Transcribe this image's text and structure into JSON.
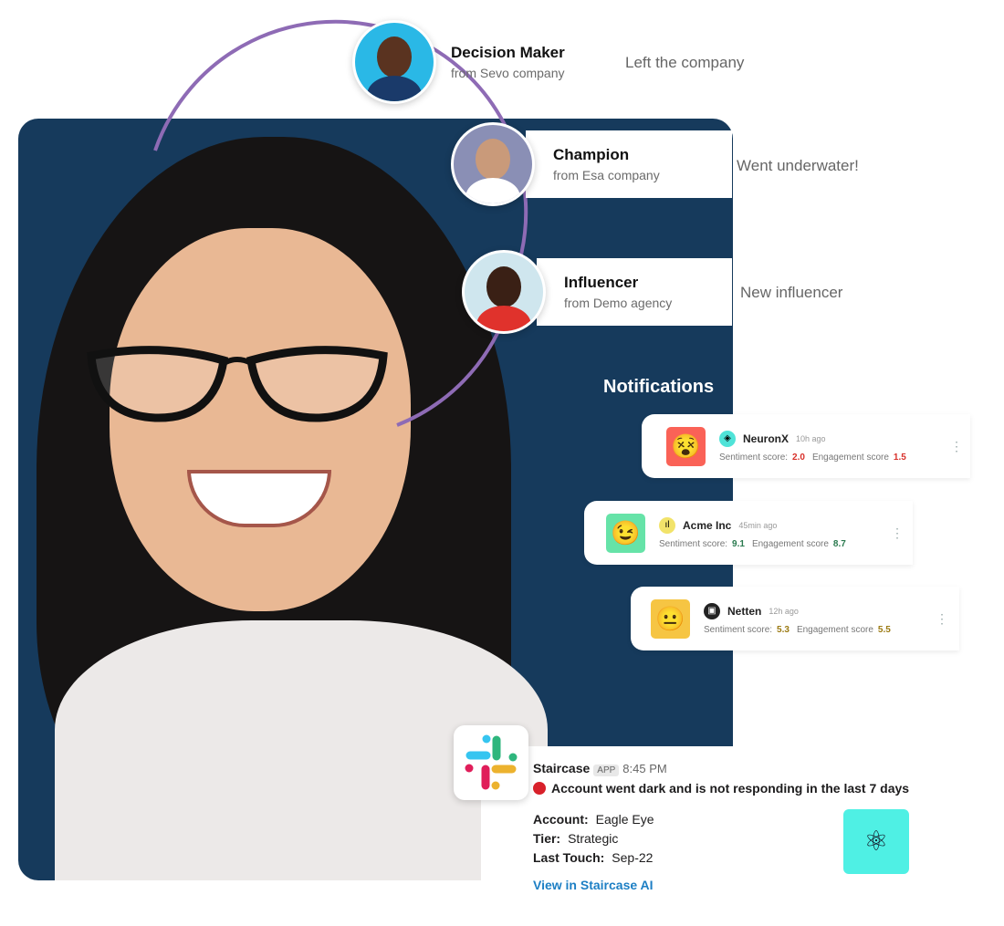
{
  "people": [
    {
      "role": "Decision Maker",
      "company": "from Sevo company",
      "status": "Left the company"
    },
    {
      "role": "Champion",
      "company": "from Esa company",
      "status": "Went underwater!"
    },
    {
      "role": "Influencer",
      "company": "from Demo agency",
      "status": "New influencer"
    }
  ],
  "notifications": {
    "title": "Notifications",
    "items": [
      {
        "name": "NeuronX",
        "time": "10h ago",
        "sentiment_label": "Sentiment score:",
        "sentiment": "2.0",
        "engagement_label": "Engagement score",
        "engagement": "1.5",
        "color": "#fa6257",
        "score_color": "#d8302a",
        "icon": "dizzy-face-icon"
      },
      {
        "name": "Acme Inc",
        "time": "45min ago",
        "sentiment_label": "Sentiment score:",
        "sentiment": "9.1",
        "engagement_label": "Engagement score",
        "engagement": "8.7",
        "color": "#66e3a8",
        "score_color": "#2b7a4f",
        "icon": "wink-face-icon"
      },
      {
        "name": "Netten",
        "time": "12h ago",
        "sentiment_label": "Sentiment score:",
        "sentiment": "5.3",
        "engagement_label": "Engagement score",
        "engagement": "5.5",
        "color": "#f6c543",
        "score_color": "#9b7a12",
        "icon": "neutral-face-icon"
      }
    ]
  },
  "slack": {
    "sender": "Staircase",
    "badge": "APP",
    "time": "8:45 PM",
    "message": "Account went dark and is not responding in the last 7 days",
    "fields": [
      {
        "label": "Account:",
        "value": "Eagle Eye"
      },
      {
        "label": "Tier:",
        "value": "Strategic"
      },
      {
        "label": "Last Touch:",
        "value": "Sep-22"
      }
    ],
    "link": "View in Staircase AI"
  },
  "colors": {
    "panel": "#163a5c",
    "arc": "#8e6bb5",
    "staircase": "#4ff0e4",
    "link": "#1d7fc4"
  }
}
